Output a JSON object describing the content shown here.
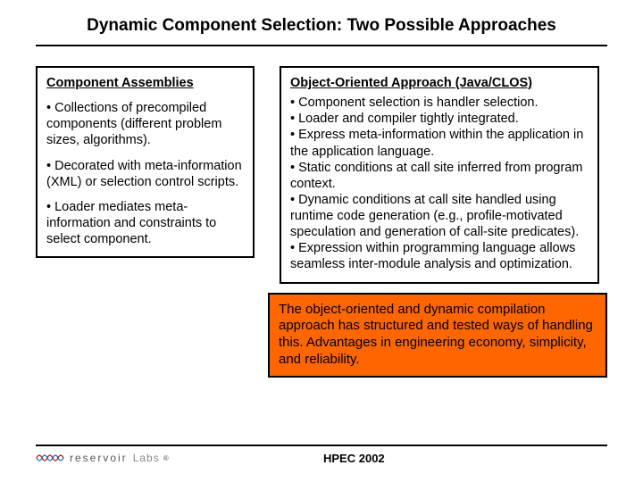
{
  "title": "Dynamic Component Selection: Two Possible Approaches",
  "left": {
    "heading": "Component Assemblies",
    "b1": "• Collections of precompiled components (different problem sizes, algorithms).",
    "b2": "• Decorated with meta-information (XML) or selection control scripts.",
    "b3": "• Loader mediates meta-information and constraints to select component."
  },
  "right": {
    "heading": "Object-Oriented Approach (Java/CLOS)",
    "b1": "• Component selection is handler selection.",
    "b2": "• Loader and compiler tightly integrated.",
    "b3": "• Express meta-information within the application in the application language.",
    "b4": "• Static conditions at call site inferred from program context.",
    "b5": "• Dynamic conditions at call site handled using runtime code generation (e.g., profile-motivated speculation and generation of call-site predicates).",
    "b6": "• Expression within programming language allows seamless inter-module analysis and optimization."
  },
  "callout": "The object-oriented and dynamic compilation approach has structured and tested ways of handling this.  Advantages in engineering economy, simplicity, and reliability.",
  "footer": {
    "logo1": "reservoir",
    "logo2": "Labs",
    "tm": "®",
    "conf": "HPEC 2002"
  }
}
